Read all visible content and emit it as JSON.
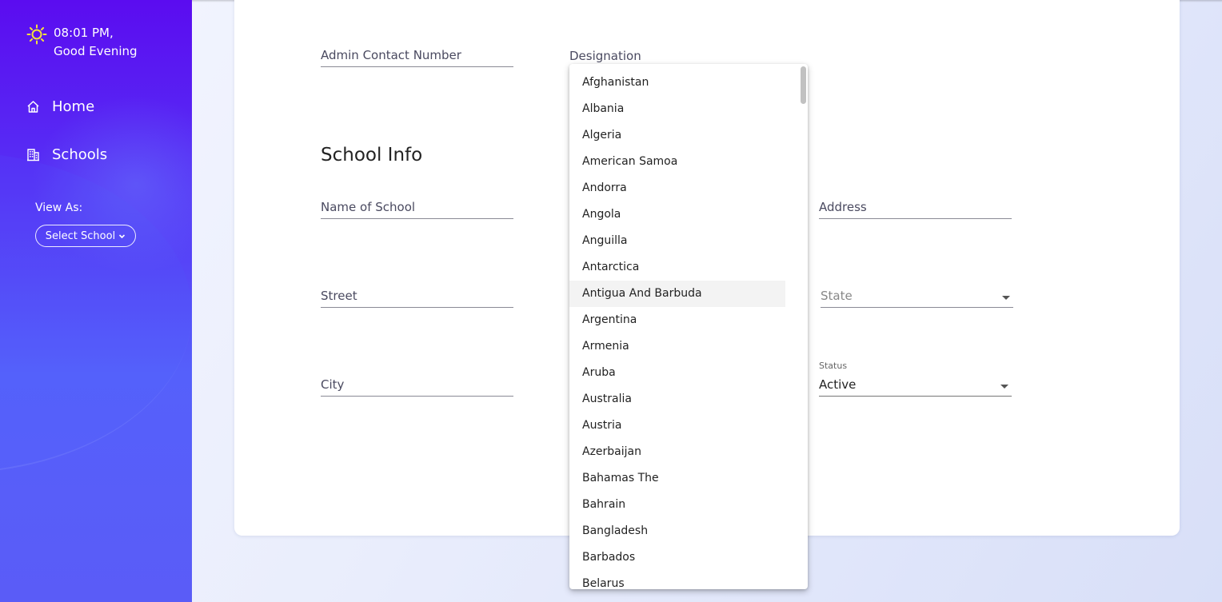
{
  "sidebar": {
    "time": "08:01 PM,",
    "greeting": "Good Evening",
    "nav": [
      {
        "label": "Home",
        "icon": "home-icon"
      },
      {
        "label": "Schools",
        "icon": "building-icon"
      }
    ],
    "view_as_label": "View As:",
    "select_school_label": "Select School"
  },
  "form": {
    "admin_contact_label": "Admin Contact Number",
    "designation_label": "Designation",
    "section_title": "School Info",
    "name_of_school_label": "Name of School",
    "address_label": "Address",
    "street_label": "Street",
    "state_label": "State",
    "city_label": "City",
    "status_label": "Status",
    "status_value": "Active"
  },
  "dropdown": {
    "options": [
      "Afghanistan",
      "Albania",
      "Algeria",
      "American Samoa",
      "Andorra",
      "Angola",
      "Anguilla",
      "Antarctica",
      "Antigua And Barbuda",
      "Argentina",
      "Armenia",
      "Aruba",
      "Australia",
      "Austria",
      "Azerbaijan",
      "Bahamas The",
      "Bahrain",
      "Bangladesh",
      "Barbados",
      "Belarus"
    ],
    "highlighted": "Antigua And Barbuda"
  },
  "colors": {
    "sidebar_top": "#5b0cf0",
    "sidebar_bottom": "#5a5cf7",
    "sun_icon": "#f3e33a",
    "highlight": "#f3f3f3"
  }
}
